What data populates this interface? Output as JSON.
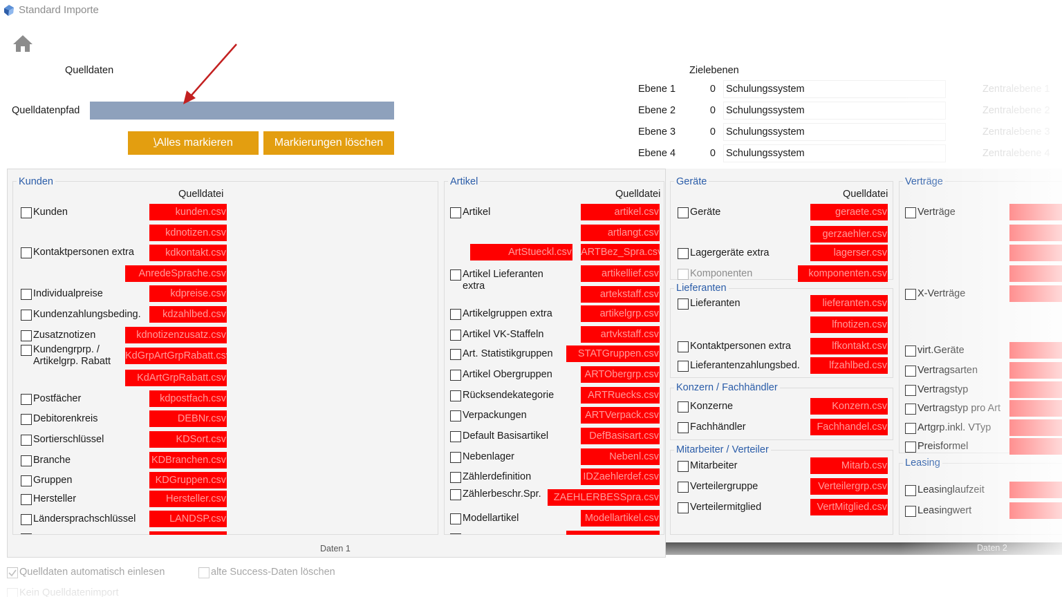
{
  "window": {
    "title": "Standard Importe"
  },
  "quelldaten": {
    "heading": "Quelldaten",
    "path_label": "Quelldatenpfad",
    "path_value": ""
  },
  "buttons": {
    "mark_all_prefix": "\\",
    "mark_all": "Alles markieren",
    "clear_marks": "Markierungen löschen"
  },
  "zielebenen": {
    "heading": "Zielebenen",
    "levels": [
      {
        "label": "Ebene 1",
        "num": "0",
        "name": "Schulungssystem",
        "zentral": "Zentralebene 1"
      },
      {
        "label": "Ebene 2",
        "num": "0",
        "name": "Schulungssystem",
        "zentral": "Zentralebene 2"
      },
      {
        "label": "Ebene 3",
        "num": "0",
        "name": "Schulungssystem",
        "zentral": "Zentralebene 3"
      },
      {
        "label": "Ebene 4",
        "num": "0",
        "name": "Schulungssystem",
        "zentral": "Zentralebene 4"
      }
    ]
  },
  "kunden": {
    "title": "Kunden",
    "col_head": "Quelldatei",
    "rows": [
      {
        "label": "Kunden",
        "checked": false
      },
      {
        "label": "Kontaktpersonen extra",
        "checked": false
      },
      {
        "label": "Individualpreise",
        "checked": false
      },
      {
        "label": "Kundenzahlungsbeding.",
        "checked": false
      },
      {
        "label": "Zusatznotizen",
        "checked": false
      },
      {
        "label": "Kundengrprp. /",
        "label2": "Artikelgrp. Rabatt",
        "checked": false
      },
      {
        "label": "Postfächer",
        "checked": false
      },
      {
        "label": "Debitorenkreis",
        "checked": false
      },
      {
        "label": "Sortierschlüssel",
        "checked": false
      },
      {
        "label": "Branche",
        "checked": false
      },
      {
        "label": "Gruppen",
        "checked": false
      },
      {
        "label": "Hersteller",
        "checked": false
      },
      {
        "label": "Ländersprachschlüssel",
        "checked": false
      }
    ],
    "files": [
      "kunden.csv",
      "kdnotizen.csv",
      "kdkontakt.csv",
      "AnredeSprache.csv",
      "kdpreise.csv",
      "kdzahlbed.csv",
      "kdnotizenzusatz.csv",
      "KdGrpArtGrpRabatt.csv",
      "KdArtGrpRabatt.csv",
      "kdpostfach.csv",
      "DEBNr.csv",
      "KDSort.csv",
      "KDBranchen.csv",
      "KDGruppen.csv",
      "Hersteller.csv",
      "LANDSP.csv"
    ]
  },
  "artikel": {
    "title": "Artikel",
    "col_head": "Quelldatei",
    "rows": [
      {
        "label": "Artikel"
      },
      {
        "label": "Artikel Lieferanten",
        "label2": "extra"
      },
      {
        "label": "Artikelgruppen extra"
      },
      {
        "label": "Artikel VK-Staffeln"
      },
      {
        "label": "Art. Statistikgruppen"
      },
      {
        "label": "Artikel Obergruppen"
      },
      {
        "label": "Rücksendekategorie"
      },
      {
        "label": "Verpackungen"
      },
      {
        "label": "Default Basisartikel"
      },
      {
        "label": "Nebenlager"
      },
      {
        "label": "Zählerdefinition"
      },
      {
        "label": "Zählerbeschr.Spr."
      },
      {
        "label": "Modellartikel"
      }
    ],
    "files": [
      "artikel.csv",
      "artlangt.csv",
      "ArtStueckl.csv",
      "ARTBez_Spra.csv",
      "artikellief.csv",
      "artekstaff.csv",
      "artikelgrp.csv",
      "artvkstaff.csv",
      "STATGruppen.csv",
      "ARTObergrp.csv",
      "ARTRuecks.csv",
      "ARTVerpack.csv",
      "DefBasisart.csv",
      "Nebenl.csv",
      "IDZaehlerdef.csv",
      "ZAEHLERBESSpra.csv",
      "Modellartikel.csv"
    ]
  },
  "geraete": {
    "title": "Geräte",
    "col_head": "Quelldatei",
    "rows": [
      {
        "label": "Geräte"
      },
      {
        "label": "Lagergeräte extra"
      },
      {
        "label": "Komponenten",
        "disabled": true
      }
    ],
    "files": [
      "geraete.csv",
      "gerzaehler.csv",
      "lagerser.csv",
      "komponenten.csv"
    ]
  },
  "lieferanten": {
    "title": "Lieferanten",
    "rows": [
      {
        "label": "Lieferanten"
      },
      {
        "label": "Kontaktpersonen extra"
      },
      {
        "label": "Lieferantenzahlungsbed."
      }
    ],
    "files": [
      "lieferanten.csv",
      "lfnotizen.csv",
      "lfkontakt.csv",
      "lfzahlbed.csv"
    ]
  },
  "konzern": {
    "title": "Konzern / Fachhändler",
    "rows": [
      {
        "label": "Konzerne"
      },
      {
        "label": "Fachhändler"
      }
    ],
    "files": [
      "Konzern.csv",
      "Fachhandel.csv"
    ]
  },
  "mitarbeiter": {
    "title": "Mitarbeiter / Verteiler",
    "rows": [
      {
        "label": "Mitarbeiter"
      },
      {
        "label": "Verteilergruppe"
      },
      {
        "label": "Verteilermitglied"
      }
    ],
    "files": [
      "Mitarb.csv",
      "Verteilergrp.csv",
      "VertMitglied.csv"
    ]
  },
  "vertraege": {
    "title": "Verträge",
    "rows": [
      {
        "label": "Verträge"
      },
      {
        "label": "X-Verträge"
      },
      {
        "label": "virt.Geräte"
      },
      {
        "label": "Vertragsarten"
      },
      {
        "label": "Vertragstyp"
      },
      {
        "label": "Vertragstyp pro Art"
      },
      {
        "label": "Artgrp.inkl. VTyp"
      },
      {
        "label": "Preisformel"
      }
    ]
  },
  "leasing": {
    "title": "Leasing",
    "rows": [
      {
        "label": "Leasinglaufzeit"
      },
      {
        "label": "Leasingwert"
      }
    ]
  },
  "tabs": {
    "tab1": "Daten 1",
    "tab2": "Daten 2"
  },
  "options": {
    "auto_read": "Quelldaten automatisch einlesen",
    "delete_old": "alte Success-Daten löschen",
    "no_header": "Kein Quelldatenimport"
  },
  "colors": {
    "accent_orange": "#e39e10",
    "file_red": "#ff0000",
    "group_title_blue": "#2a5ca8",
    "path_field": "#8ea1bc"
  }
}
